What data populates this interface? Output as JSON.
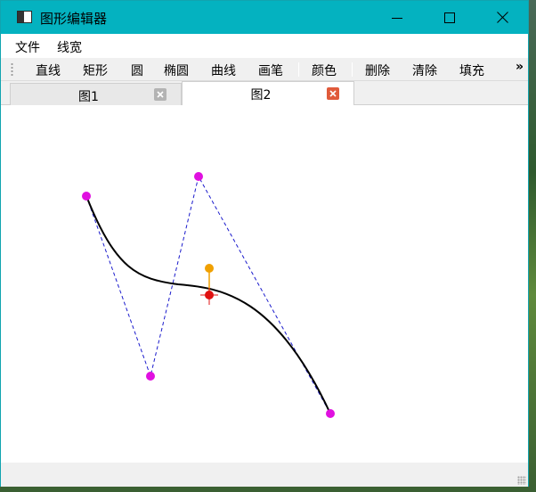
{
  "window": {
    "title": "图形编辑器",
    "controls": {
      "minimize_icon": "minimize-icon",
      "maximize_icon": "maximize-icon",
      "close_icon": "close-icon"
    }
  },
  "menubar": {
    "items": [
      "文件",
      "线宽"
    ]
  },
  "toolbar": {
    "items": [
      "直线",
      "矩形",
      "圆",
      "椭圆",
      "曲线",
      "画笔",
      "颜色",
      "删除",
      "清除",
      "填充"
    ],
    "overflow_label": "»"
  },
  "tabs": [
    {
      "label": "图1",
      "active": false
    },
    {
      "label": "图2",
      "active": true
    }
  ],
  "canvas": {
    "curve_type": "cubic bezier",
    "control_point_color": "#e010e0",
    "control_polygon_color": "#1a1acc",
    "curve_color": "#000000",
    "selected_point_color": "#e01010",
    "handle_color": "#f0a000"
  },
  "colors": {
    "titlebar": "#04b2c0",
    "accent_close": "#e05a3a"
  }
}
